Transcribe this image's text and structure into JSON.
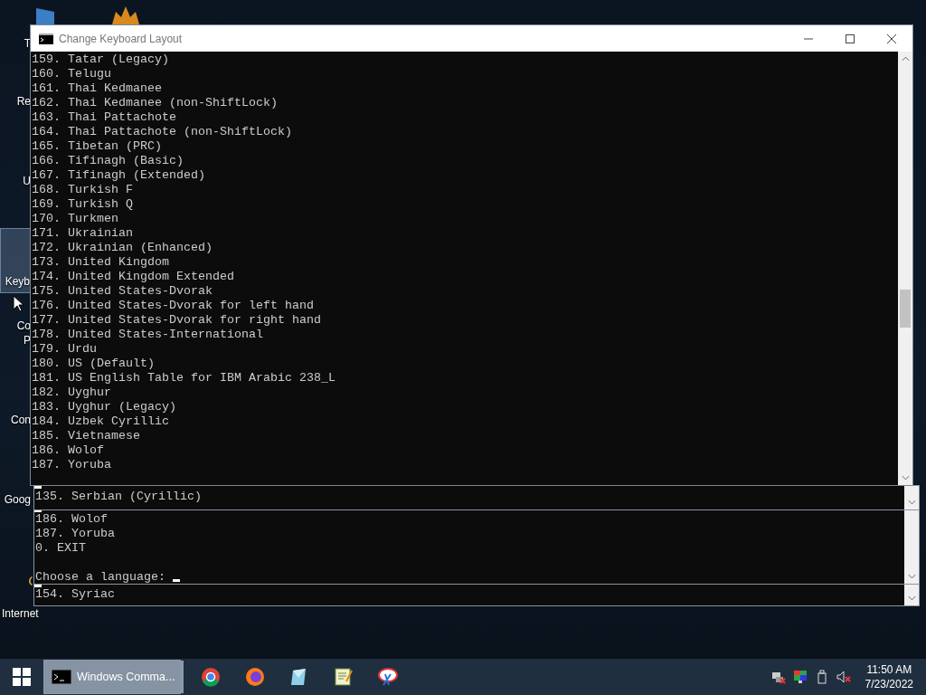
{
  "desktop": {
    "icons": [
      {
        "label": "T",
        "selected": false
      },
      {
        "label": "Re",
        "selected": false
      },
      {
        "label": "U",
        "selected": false
      },
      {
        "label": "Keyb",
        "selected": true
      },
      {
        "label": "Co",
        "label_2": "P",
        "selected": false
      },
      {
        "label": "Con",
        "selected": false
      },
      {
        "label": "Goog",
        "selected": false
      },
      {
        "label": "Internet",
        "selected": false
      }
    ]
  },
  "background_consoles": [
    {
      "lines": [
        "135. Serbian (Cyrillic)"
      ]
    },
    {
      "lines": [
        "186. Wolof",
        "187. Yoruba",
        "0. EXIT"
      ],
      "prompt": "Choose a language:"
    },
    {
      "lines": [
        "154. Syriac"
      ]
    }
  ],
  "window": {
    "title": "Change Keyboard Layout",
    "lines": [
      "159. Tatar (Legacy)",
      "160. Telugu",
      "161. Thai Kedmanee",
      "162. Thai Kedmanee (non-ShiftLock)",
      "163. Thai Pattachote",
      "164. Thai Pattachote (non-ShiftLock)",
      "165. Tibetan (PRC)",
      "166. Tifinagh (Basic)",
      "167. Tifinagh (Extended)",
      "168. Turkish F",
      "169. Turkish Q",
      "170. Turkmen",
      "171. Ukrainian",
      "172. Ukrainian (Enhanced)",
      "173. United Kingdom",
      "174. United Kingdom Extended",
      "175. United States-Dvorak",
      "176. United States-Dvorak for left hand",
      "177. United States-Dvorak for right hand",
      "178. United States-International",
      "179. Urdu",
      "180. US (Default)",
      "181. US English Table for IBM Arabic 238_L",
      "182. Uyghur",
      "183. Uyghur (Legacy)",
      "184. Uzbek Cyrillic",
      "185. Vietnamese",
      "186. Wolof",
      "187. Yoruba"
    ]
  },
  "taskbar": {
    "apps": [
      {
        "label": "Windows Comma...",
        "selected": true
      }
    ],
    "clock": {
      "time": "11:50 AM",
      "date": "7/23/2022"
    }
  }
}
